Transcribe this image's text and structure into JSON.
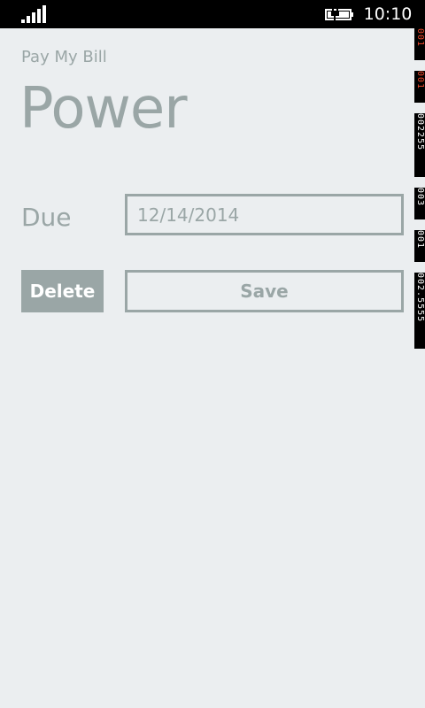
{
  "status_bar": {
    "time": "10:10",
    "signal_icon": "signal-strength-icon",
    "battery_icon": "battery-charging-icon"
  },
  "app": {
    "title": "Pay My Bill",
    "page_title": "Power"
  },
  "form": {
    "due_label": "Due",
    "due_value": "12/14/2014"
  },
  "actions": {
    "delete_label": "Delete",
    "save_label": "Save"
  },
  "frame_counters": [
    {
      "value": "001",
      "color": "#e8462a"
    },
    {
      "value": "001",
      "color": "#e8462a"
    },
    {
      "value": "002255",
      "color": "#ffffff"
    },
    {
      "value": "003",
      "color": "#ffffff"
    },
    {
      "value": "001",
      "color": "#ffffff"
    },
    {
      "value": "002.5555",
      "color": "#ffffff"
    }
  ],
  "colors": {
    "background": "#ebeef0",
    "accent": "#9aa6a6",
    "status_bar": "#000000"
  }
}
